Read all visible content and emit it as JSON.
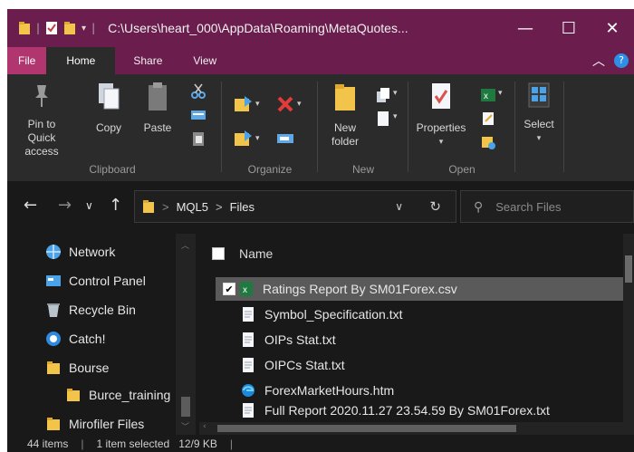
{
  "window": {
    "title": "C:\\Users\\heart_000\\AppData\\Roaming\\MetaQuotes...",
    "controls": {
      "minimize": "—",
      "maximize": "☐",
      "close": "✕"
    }
  },
  "tabs": [
    {
      "label": "File"
    },
    {
      "label": "Home"
    },
    {
      "label": "Share"
    },
    {
      "label": "View"
    }
  ],
  "ribbon": {
    "clipboard": {
      "label": "Clipboard",
      "pin_label": "Pin to Quick access",
      "copy_label": "Copy",
      "paste_label": "Paste"
    },
    "organize": {
      "label": "Organize"
    },
    "new": {
      "label": "New",
      "new_folder_label": "New folder"
    },
    "open": {
      "label": "Open",
      "properties_label": "Properties"
    },
    "select": {
      "label": "Select"
    }
  },
  "address": {
    "segments": [
      "MQL5",
      "Files"
    ],
    "separator": ">",
    "search_placeholder": "Search Files"
  },
  "nav_items": [
    {
      "label": "Network",
      "icon": "network-icon"
    },
    {
      "label": "Control Panel",
      "icon": "control-panel-icon"
    },
    {
      "label": "Recycle Bin",
      "icon": "recycle-bin-icon"
    },
    {
      "label": "Catch!",
      "icon": "catch-icon"
    },
    {
      "label": "Bourse",
      "icon": "folder-icon"
    },
    {
      "label": "Burce_training",
      "icon": "folder-icon"
    },
    {
      "label": "Mirofiler Files",
      "icon": "folder-icon"
    }
  ],
  "content": {
    "column_name": "Name",
    "files": [
      {
        "name": "Ratings Report By SM01Forex.csv",
        "icon": "excel-csv-icon",
        "selected": true
      },
      {
        "name": "Symbol_Specification.txt",
        "icon": "text-file-icon",
        "selected": false
      },
      {
        "name": "OIPs Stat.txt",
        "icon": "text-file-icon",
        "selected": false
      },
      {
        "name": "OIPCs Stat.txt",
        "icon": "text-file-icon",
        "selected": false
      },
      {
        "name": "ForexMarketHours.htm",
        "icon": "edge-html-icon",
        "selected": false
      },
      {
        "name": "Full Report 2020.11.27 23.54.59 By SM01Forex.txt",
        "icon": "text-file-icon",
        "selected": false
      }
    ]
  },
  "status": {
    "items_count": "44 items",
    "selected": "1 item selected",
    "size": "12/9 KB"
  },
  "colors": {
    "titlebar": "#6b1e4e",
    "file_tab": "#b1356f",
    "background": "#191919",
    "ribbon": "#2b2b2b",
    "selection": "#5a5a5a"
  }
}
